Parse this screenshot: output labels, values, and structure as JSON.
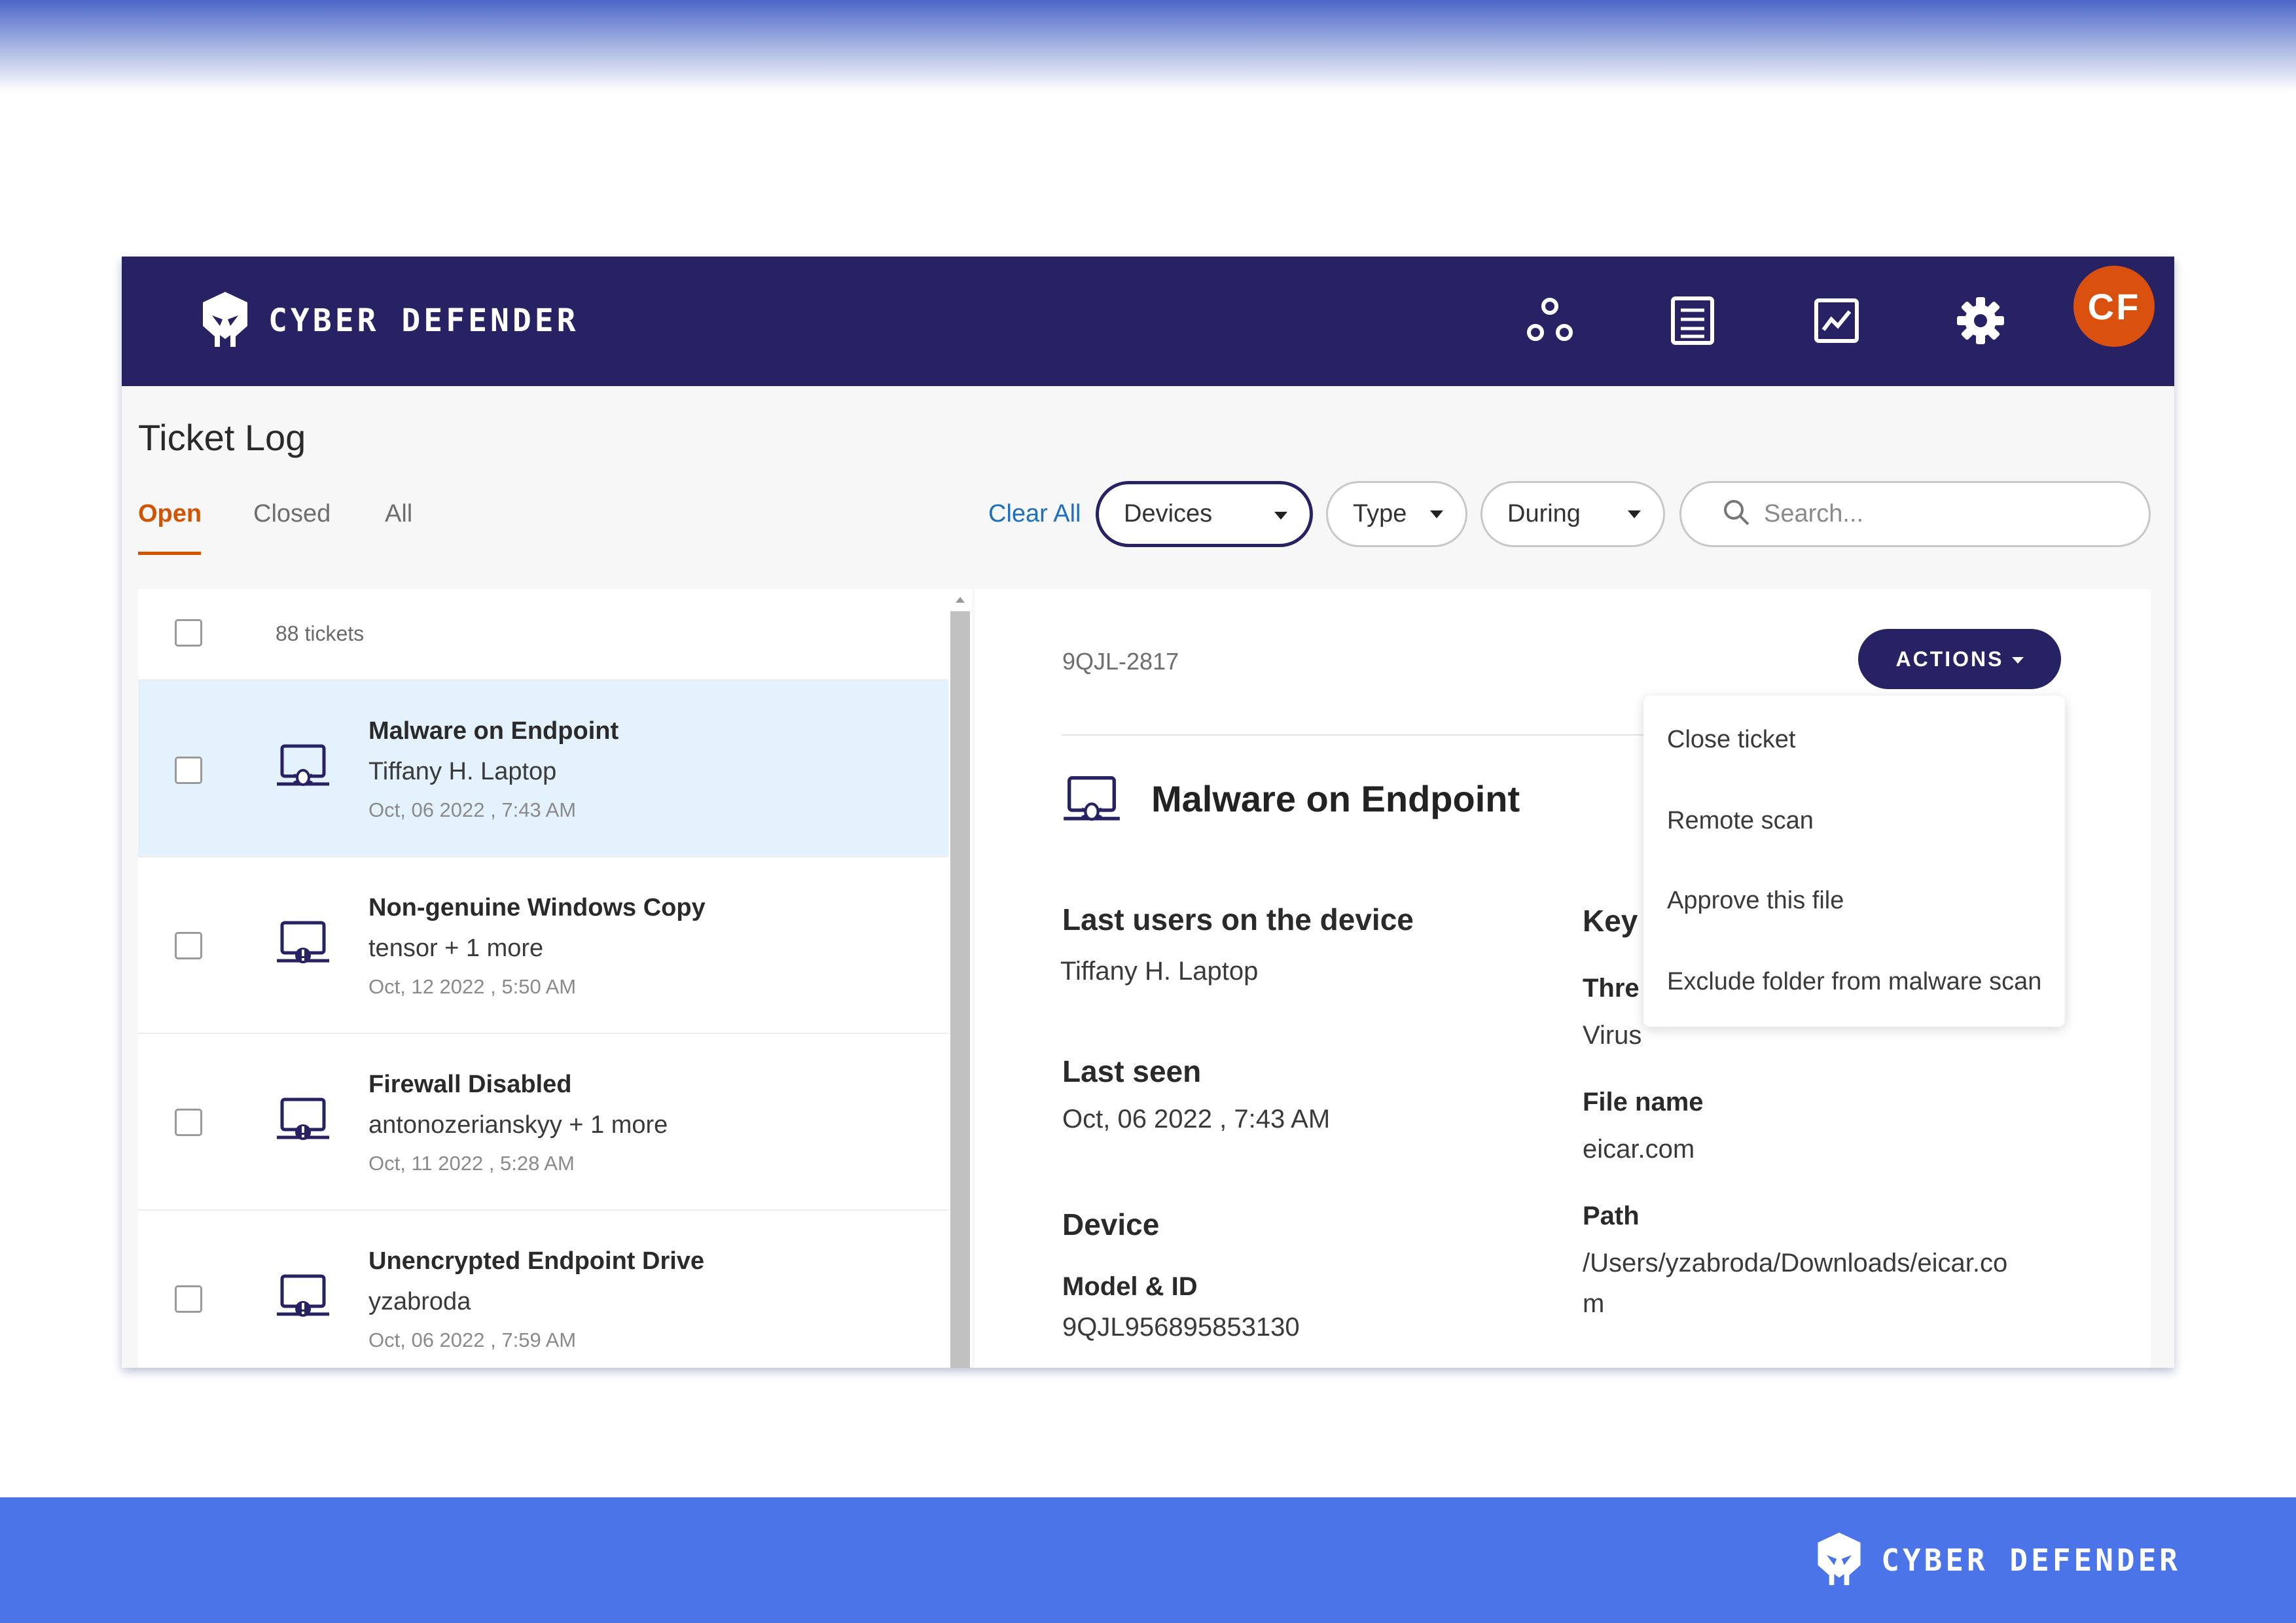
{
  "brand": {
    "name": "CYBER DEFENDER"
  },
  "navbar": {
    "icons": [
      "nodes-icon",
      "list-icon",
      "chart-icon",
      "gear-icon"
    ],
    "avatar_initials": "CF"
  },
  "page": {
    "title": "Ticket Log",
    "tabs": [
      {
        "label": "Open",
        "active": true
      },
      {
        "label": "Closed",
        "active": false
      },
      {
        "label": "All",
        "active": false
      }
    ]
  },
  "filters": {
    "clear_all": "Clear All",
    "devices": "Devices",
    "type": "Type",
    "during": "During",
    "search_placeholder": "Search..."
  },
  "ticket_list": {
    "count_label": "88 tickets",
    "tickets": [
      {
        "title": "Malware on Endpoint",
        "user": "Tiffany H. Laptop",
        "date": "Oct, 06 2022 , 7:43 AM",
        "icon": "laptop-bug-icon",
        "selected": true
      },
      {
        "title": "Non-genuine Windows Copy",
        "user": "tensor + 1 more",
        "date": "Oct, 12 2022 , 5:50 AM",
        "icon": "laptop-alert-icon",
        "selected": false
      },
      {
        "title": "Firewall Disabled",
        "user": "antonozerianskyy + 1 more",
        "date": "Oct, 11 2022 , 5:28 AM",
        "icon": "laptop-alert-icon",
        "selected": false
      },
      {
        "title": "Unencrypted Endpoint Drive",
        "user": "yzabroda",
        "date": "Oct, 06 2022 , 7:59 AM",
        "icon": "laptop-alert-icon",
        "selected": false
      }
    ]
  },
  "detail": {
    "ticket_id": "9QJL-2817",
    "actions_label": "ACTIONS",
    "title": "Malware on Endpoint",
    "last_users_label": "Last users on the device",
    "last_users_value": "Tiffany H. Laptop",
    "last_seen_label": "Last seen",
    "last_seen_value": "Oct, 06 2022 , 7:43 AM",
    "device_label": "Device",
    "model_id_label": "Model & ID",
    "model_id_value": "9QJL956895853130",
    "key_label": "Key",
    "threat_label": "Thre",
    "threat_value": "Virus",
    "file_name_label": "File name",
    "file_name_value": "eicar.com",
    "path_label": "Path",
    "path_value_line1": "/Users/yzabroda/Downloads/eicar.co",
    "path_value_line2": "m"
  },
  "actions_menu": {
    "items": [
      "Close ticket",
      "Remote scan",
      "Approve this file",
      "Exclude folder from malware scan"
    ]
  },
  "colors": {
    "navbar": "#262263",
    "accent_orange": "#d35400",
    "avatar": "#d9500f",
    "link_blue": "#1f6fbf",
    "selected_row": "#e3f2fc",
    "footer_band": "#4a74e8"
  }
}
